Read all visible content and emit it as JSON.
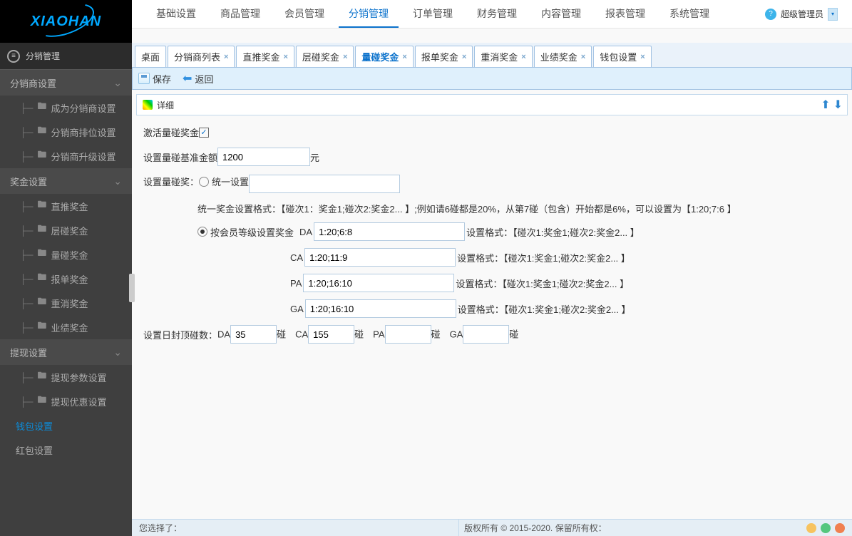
{
  "logo": {
    "text": "XIAOHAN"
  },
  "topnav": {
    "items": [
      "基础设置",
      "商品管理",
      "会员管理",
      "分销管理",
      "订单管理",
      "财务管理",
      "内容管理",
      "报表管理",
      "系统管理"
    ],
    "active_index": 3,
    "user_label": "超级管理员",
    "user_dropdown": "▾"
  },
  "sidebar": {
    "header": "分销管理",
    "groups": [
      {
        "title": "分销商设置",
        "links": [
          "成为分销商设置",
          "分销商排位设置",
          "分销商升级设置"
        ]
      },
      {
        "title": "奖金设置",
        "links": [
          "直推奖金",
          "层碰奖金",
          "量碰奖金",
          "报单奖金",
          "重消奖金",
          "业绩奖金"
        ]
      },
      {
        "title": "提现设置",
        "links": [
          "提现参数设置",
          "提现优惠设置"
        ]
      }
    ],
    "simple_links": [
      "钱包设置",
      "红包设置"
    ],
    "active_simple": "钱包设置"
  },
  "tabs": {
    "items": [
      "桌面",
      "分销商列表",
      "直推奖金",
      "层碰奖金",
      "量碰奖金",
      "报单奖金",
      "重消奖金",
      "业绩奖金",
      "钱包设置"
    ],
    "closable_from": 1,
    "active_index": 4
  },
  "toolbar": {
    "save_label": "保存",
    "back_label": "返回"
  },
  "panel": {
    "detail_label": "详细"
  },
  "form": {
    "activate_label": "激活量碰奖金",
    "activate_checked": true,
    "base_label": "设置量碰基准金额",
    "base_value": "1200",
    "base_unit": "元",
    "mode_label": "设置量碰奖：",
    "option_unified": "统一设置",
    "option_bylevel": "按会员等级设置奖金",
    "option_checked": "bylevel",
    "unified_value": "",
    "unified_hint": "统一奖金设置格式：【碰次1：奖金1;碰次2:奖金2... 】;例如请6碰都是20%，从第7碰（包含）开始都是6%，可以设置为【1:20;7:6 】",
    "levels": [
      {
        "code": "DA",
        "value": "1:20;6:8",
        "hint": "设置格式：【碰次1:奖金1;碰次2:奖金2... 】"
      },
      {
        "code": "CA",
        "value": "1:20;11:9",
        "hint": "设置格式：【碰次1:奖金1;碰次2:奖金2... 】"
      },
      {
        "code": "PA",
        "value": "1:20;16:10",
        "hint": "设置格式：【碰次1:奖金1;碰次2:奖金2... 】"
      },
      {
        "code": "GA",
        "value": "1:20;16:10",
        "hint": "设置格式：【碰次1:奖金1;碰次2:奖金2... 】"
      }
    ],
    "cap_label": "设置日封顶碰数：",
    "cap_unit": "碰",
    "caps": [
      {
        "code": "DA",
        "value": "35"
      },
      {
        "code": "CA",
        "value": "155"
      },
      {
        "code": "PA",
        "value": ""
      },
      {
        "code": "GA",
        "value": ""
      }
    ]
  },
  "footer": {
    "selected_label": "您选择了：",
    "copyright": "版权所有 © 2015-2020. 保留所有权："
  }
}
